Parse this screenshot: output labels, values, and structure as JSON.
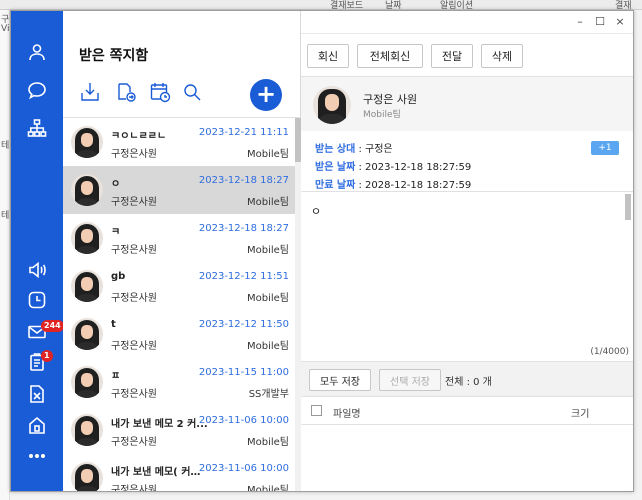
{
  "background": {
    "top_texts": [
      "결재보드",
      "날짜",
      "알림이션",
      "결재"
    ],
    "left_texts": [
      "구",
      "Vi",
      "테",
      "테"
    ]
  },
  "window": {
    "minimize_label": "–",
    "maximize_label": "☐",
    "close_label": "×"
  },
  "rail": {
    "accent_color": "#1a5bd6",
    "icons": [
      "person-icon",
      "chat-bubble-icon",
      "org-chart-icon",
      "speaker-icon",
      "clock-icon",
      "mail-icon",
      "clipboard-icon",
      "document-x-icon",
      "home-icon",
      "more-icon"
    ],
    "mail_badge": "244",
    "clipboard_badge": "1"
  },
  "list": {
    "title": "받은 쪽지함",
    "tools": [
      "download-icon",
      "forward-icon",
      "calendar-icon",
      "search-icon"
    ],
    "add_label": "+",
    "items": [
      {
        "subject": "ㅋㅇㄴㄹㄹㄴ",
        "date": "2023-12-21 11:11",
        "name": "구정은사원",
        "team": "Mobile팀",
        "selected": false
      },
      {
        "subject": "ㅇ",
        "date": "2023-12-18 18:27",
        "name": "구정은사원",
        "team": "Mobile팀",
        "selected": true
      },
      {
        "subject": "ㅋ",
        "date": "2023-12-18 18:27",
        "name": "구정은사원",
        "team": "Mobile팀",
        "selected": false
      },
      {
        "subject": "gb",
        "date": "2023-12-12 11:51",
        "name": "구정은사원",
        "team": "Mobile팀",
        "selected": false
      },
      {
        "subject": "t",
        "date": "2023-12-12 11:50",
        "name": "구정은사원",
        "team": "Mobile팀",
        "selected": false
      },
      {
        "subject": "ㅍ",
        "date": "2023-11-15 11:00",
        "name": "구정은사원",
        "team": "SS개발부",
        "selected": false
      },
      {
        "subject": "내가 보낸 메모 2 커...",
        "date": "2023-11-06 10:00",
        "name": "구정은사원",
        "team": "Mobile팀",
        "selected": false
      },
      {
        "subject": "내가 보낸 메모( 커서...",
        "date": "2023-11-06 10:00",
        "name": "구정은사원",
        "team": "Mobile팀",
        "selected": false
      }
    ]
  },
  "detail": {
    "buttons": {
      "reply": "회신",
      "reply_all": "전체회신",
      "forward": "전달",
      "delete": "삭제"
    },
    "sender_name": "구정은 사원",
    "sender_team": "Mobile팀",
    "recipient_label": "받는 상대",
    "recipient_value": " : 구정은",
    "extra_recipients": "+1",
    "received_label": "받은 날짜",
    "received_value": " : 2023-12-18 18:27:59",
    "expire_label": "만료 날짜",
    "expire_value": " : 2028-12-18 18:27:59",
    "body": "ㅇ",
    "char_counter": "(1/4000)",
    "save_all_label": "모두 저장",
    "save_selected_label": "선택 저장",
    "total_label": "전체 : 0 개",
    "file_col_name": "파일명",
    "file_col_size": "크기"
  }
}
